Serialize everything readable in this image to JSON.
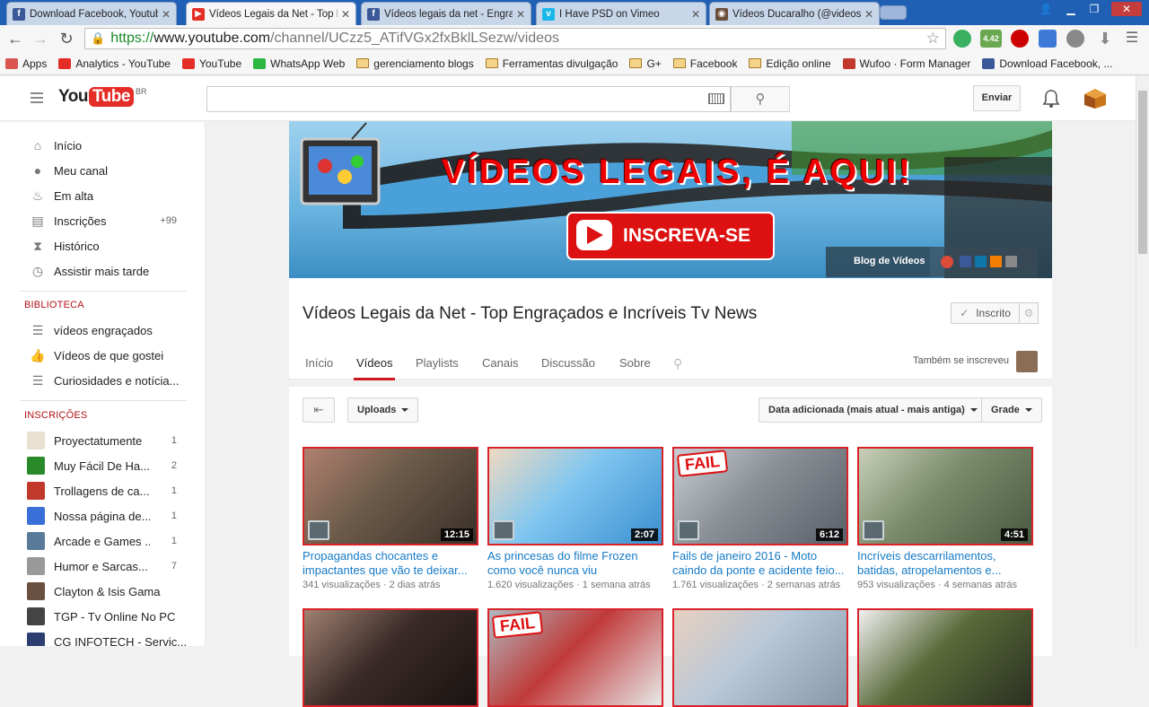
{
  "browser": {
    "tabs": [
      {
        "title": "Download Facebook, Youtub",
        "favicon_color": "#3b5998",
        "favicon_glyph": "f"
      },
      {
        "title": "Vídeos Legais da Net - Top E",
        "favicon_color": "#e52d27",
        "favicon_glyph": "▶"
      },
      {
        "title": "Vídeos legais da net - Engra",
        "favicon_color": "#3b5998",
        "favicon_glyph": "f"
      },
      {
        "title": "I Have PSD on Vimeo",
        "favicon_color": "#1ab7ea",
        "favicon_glyph": "v"
      },
      {
        "title": "Vídeos Ducaralho (@videosd",
        "favicon_color": "#6b4f3a",
        "favicon_glyph": "◉"
      }
    ],
    "url": {
      "scheme": "https://",
      "host": "www.youtube.com",
      "path": "/channel/UCzz5_ATifVGx2fxBklLSezw/videos"
    },
    "bookmarks": [
      {
        "label": "Apps",
        "icon": "apps-grid"
      },
      {
        "label": "Analytics - YouTube",
        "icon": "youtube"
      },
      {
        "label": "YouTube",
        "icon": "youtube"
      },
      {
        "label": "WhatsApp Web",
        "icon": "whatsapp"
      },
      {
        "label": "gerenciamento blogs",
        "icon": "folder"
      },
      {
        "label": "Ferramentas divulgação",
        "icon": "folder"
      },
      {
        "label": "G+",
        "icon": "folder"
      },
      {
        "label": "Facebook",
        "icon": "folder"
      },
      {
        "label": "Edição online",
        "icon": "folder"
      },
      {
        "label": "Wufoo · Form Manager",
        "icon": "wufoo"
      },
      {
        "label": "Download Facebook, ...",
        "icon": "facebook"
      }
    ],
    "extension_badge": "4.42"
  },
  "masthead": {
    "logo_region": "BR",
    "upload_label": "Enviar"
  },
  "sidebar": {
    "nav": [
      {
        "label": "Início",
        "icon": "home-icon",
        "glyph": "⌂"
      },
      {
        "label": "Meu canal",
        "icon": "user-icon",
        "glyph": "●"
      },
      {
        "label": "Em alta",
        "icon": "flame-icon",
        "glyph": "♨"
      },
      {
        "label": "Inscrições",
        "icon": "subscriptions-icon",
        "glyph": "▤",
        "count": "+99"
      },
      {
        "label": "Histórico",
        "icon": "hourglass-icon",
        "glyph": "⧗"
      },
      {
        "label": "Assistir mais tarde",
        "icon": "clock-icon",
        "glyph": "◷"
      }
    ],
    "library_heading": "BIBLIOTECA",
    "library": [
      {
        "label": "vídeos engraçados",
        "icon": "playlist-icon",
        "glyph": "☰"
      },
      {
        "label": "Vídeos de que gostei",
        "icon": "thumbs-up-icon",
        "glyph": "👍"
      },
      {
        "label": "Curiosidades e notícia...",
        "icon": "playlist-icon",
        "glyph": "☰"
      }
    ],
    "subs_heading": "INSCRIÇÕES",
    "subscriptions": [
      {
        "label": "Proyectatumente",
        "count": "1",
        "color": "#e8e0d0"
      },
      {
        "label": "Muy Fácil De Ha...",
        "count": "2",
        "color": "#2a8a2a"
      },
      {
        "label": "Trollagens de ca...",
        "count": "1",
        "color": "#c0392b"
      },
      {
        "label": "Nossa página de...",
        "count": "1",
        "color": "#3a6fd8"
      },
      {
        "label": "Arcade e Games ...",
        "count": "1",
        "color": "#5a7a9a"
      },
      {
        "label": "Humor e Sarcas...",
        "count": "7",
        "color": "#999999"
      },
      {
        "label": "Clayton & Isis Gama",
        "count": "",
        "color": "#6a5040"
      },
      {
        "label": "TGP - Tv Online No PC",
        "count": "",
        "color": "#444444"
      },
      {
        "label": "CG INFOTECH - Servic...",
        "count": "",
        "color": "#2c3e70"
      }
    ]
  },
  "channel": {
    "banner_headline": "VÍDEOS LEGAIS, É AQUI!",
    "banner_cta": "INSCREVA-SE",
    "banner_link": "Blog de Vídeos",
    "title": "Vídeos Legais da Net - Top Engraçados e Incríveis Tv News",
    "subscribe_label": "Inscrito",
    "tabs": [
      "Início",
      "Vídeos",
      "Playlists",
      "Canais",
      "Discussão",
      "Sobre"
    ],
    "active_tab": "Vídeos",
    "also_subscribed": "Também se inscreveu"
  },
  "videos_toolbar": {
    "uploads_label": "Uploads",
    "sort_label": "Data adicionada (mais atual - mais antiga)",
    "view_label": "Grade"
  },
  "videos": [
    {
      "title": "Propagandas chocantes e impactantes que vão te deixar...",
      "duration": "12:15",
      "views": "341 visualizações",
      "age": "2 dias atrás",
      "thumb": [
        "#6b5a48",
        "#3a3028",
        "#b08070"
      ]
    },
    {
      "title": "As princesas do filme Frozen como você nunca viu",
      "duration": "2:07",
      "views": "1.620 visualizações",
      "age": "1 semana atrás",
      "thumb": [
        "#7fc6f0",
        "#3a8ed0",
        "#f0d9c0"
      ]
    },
    {
      "title": "Fails de janeiro 2016 - Moto caindo da ponte e acidente feio...",
      "duration": "6:12",
      "views": "1.761 visualizações",
      "age": "2 semanas atrás",
      "thumb": [
        "#8a8f96",
        "#5a6068",
        "#c9ced4"
      ],
      "badge": "FAIL"
    },
    {
      "title": "Incríveis descarrilamentos, batidas, atropelamentos e...",
      "duration": "4:51",
      "views": "953 visualizações",
      "age": "4 semanas atrás",
      "thumb": [
        "#7a8a6a",
        "#4a5a40",
        "#c8d0b8"
      ]
    },
    {
      "title": "",
      "thumb": [
        "#3a2a28",
        "#1a1412",
        "#a08070"
      ]
    },
    {
      "title": "",
      "thumb": [
        "#c03a3a",
        "#e8e8e8",
        "#b0b8c0"
      ],
      "badge": "FAIL"
    },
    {
      "title": "",
      "thumb": [
        "#b8c8d8",
        "#8898a8",
        "#e8d0c0"
      ]
    },
    {
      "title": "",
      "thumb": [
        "#5a6a3a",
        "#2a3020",
        "#f0f0f0"
      ]
    }
  ]
}
